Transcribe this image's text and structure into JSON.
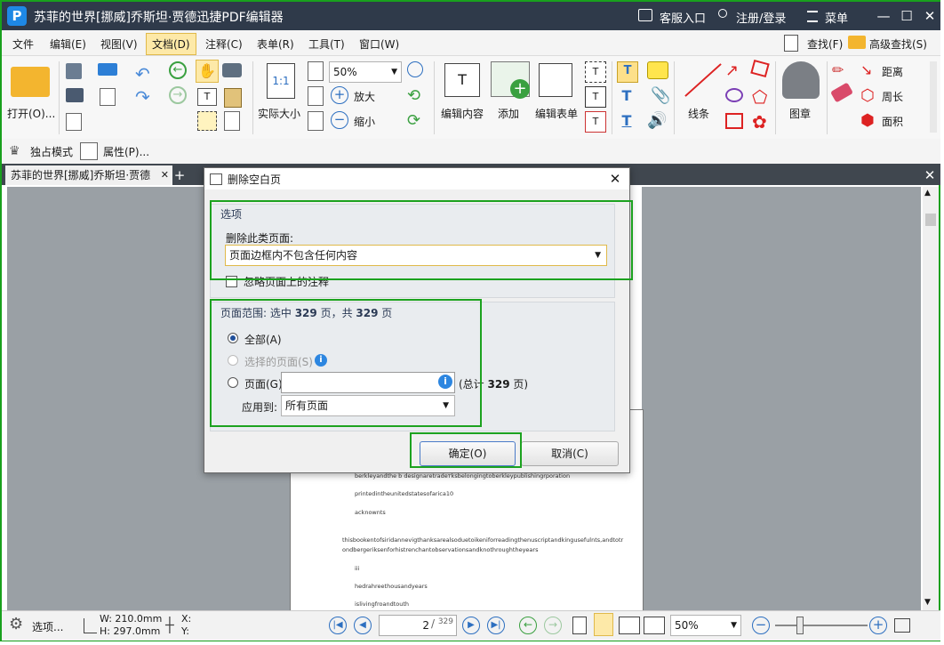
{
  "window": {
    "title": "苏菲的世界[挪威]乔斯坦·贾德迅捷PDF编辑器",
    "logo": "P",
    "service": "客服入口",
    "account": "注册/登录",
    "menu": "菜单"
  },
  "menubar": {
    "items": [
      "文件",
      "编辑(E)",
      "视图(V)",
      "文档(D)",
      "注释(C)",
      "表单(R)",
      "工具(T)",
      "窗口(W)"
    ],
    "search": "查找(F)",
    "advanced_search": "高级查找(S)"
  },
  "ribbon": {
    "open": "打开(O)...",
    "zoom_value": "50%",
    "actual_size": "实际大小",
    "zoom_in": "放大",
    "zoom_out": "缩小",
    "edit_content": "编辑内容",
    "add": "添加",
    "edit_form": "编辑表单",
    "lines": "线条",
    "stamp": "图章",
    "distance": "距离",
    "perimeter": "周长",
    "area": "面积",
    "fit_label": "1:1"
  },
  "toolbar2": {
    "exclusive_mode": "独占模式",
    "properties": "属性(P)..."
  },
  "tabs": {
    "doc_tab": "苏菲的世界[挪威]乔斯坦·贾德"
  },
  "dialog": {
    "title": "删除空白页",
    "options_header": "选项",
    "delete_label": "删除此类页面:",
    "delete_value": "页面边框内不包含任何内容",
    "ignore_annotations": "忽略页面上的注释",
    "range_header_prefix": "页面范围: 选中 ",
    "range_selected": "329",
    "range_mid": " 页，共 ",
    "range_total": "329",
    "range_suffix": " 页",
    "all": "全部(A)",
    "selected_pages": "选择的页面(S)",
    "pages": "页面(G)",
    "total_prefix": "(总计 ",
    "total_num": "329",
    "total_suffix": " 页)",
    "apply_to": "应用到:",
    "apply_value": "所有页面",
    "ok": "确定(O)",
    "cancel": "取消(C)"
  },
  "page_text": {
    "l1": "berkleyandthe    b    designaretradeтksbelongingtoberkleypublishingrporation",
    "l2": "printedintheunitedstatesofarica10",
    "l3": "acknownts",
    "l4": "thisbookentofsiridannevigthanksarealsoduetoikeniforreadingthenuscriptandkingusefulnts,andtotr",
    "l5": "ondbergeriksenforhistrenchantobservationsandknothroughtheyears",
    "l6": "iii",
    "l7": "hedrahreethousandyears",
    "l8": "islivingfroandtouth"
  },
  "status": {
    "options": "选项...",
    "width": "W: 210.0mm",
    "height": "H: 297.0mm",
    "x": "X:",
    "y": "Y:",
    "page_num": "2",
    "page_total": "329",
    "zoom": "50%"
  },
  "colors": {
    "accent_green": "#1ca21f",
    "title_bg": "#2f3a4a",
    "tab_bg": "#40474f"
  }
}
